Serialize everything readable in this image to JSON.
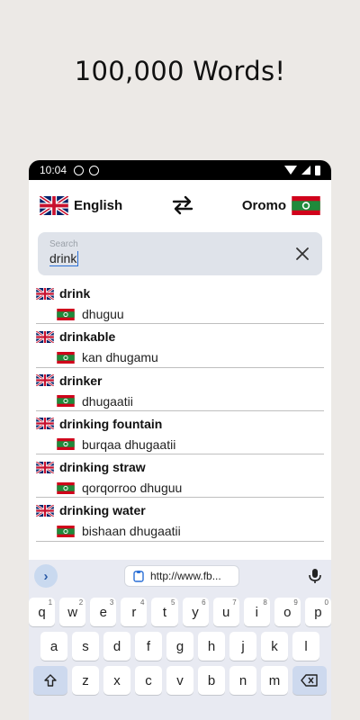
{
  "promo": {
    "headline": "100,000 Words!"
  },
  "status_bar": {
    "time": "10:04"
  },
  "language_bar": {
    "source_language": "English",
    "target_language": "Oromo",
    "source_flag_icon": "uk-flag-icon",
    "target_flag_icon": "oromo-flag-icon",
    "swap_icon": "swap-arrows-icon"
  },
  "search": {
    "placeholder": "Search",
    "value": "drink",
    "clear_icon": "close-icon"
  },
  "results": [
    {
      "en": "drink",
      "om": "dhuguu"
    },
    {
      "en": "drinkable",
      "om": "kan dhugamu"
    },
    {
      "en": "drinker",
      "om": "dhugaatii"
    },
    {
      "en": "drinking fountain",
      "om": "burqaa dhugaatii"
    },
    {
      "en": "drinking straw",
      "om": "qorqorroo dhuguu"
    },
    {
      "en": "drinking water",
      "om": "bishaan dhugaatii"
    }
  ],
  "keyboard": {
    "suggestion_url": "http://www.fb...",
    "expand_icon": "chevron-right-icon",
    "mic_icon": "mic-icon",
    "row1": [
      {
        "k": "q",
        "n": "1"
      },
      {
        "k": "w",
        "n": "2"
      },
      {
        "k": "e",
        "n": "3"
      },
      {
        "k": "r",
        "n": "4"
      },
      {
        "k": "t",
        "n": "5"
      },
      {
        "k": "y",
        "n": "6"
      },
      {
        "k": "u",
        "n": "7"
      },
      {
        "k": "i",
        "n": "8"
      },
      {
        "k": "o",
        "n": "9"
      },
      {
        "k": "p",
        "n": "0"
      }
    ],
    "row2": [
      "a",
      "s",
      "d",
      "f",
      "g",
      "h",
      "j",
      "k",
      "l"
    ],
    "row3": [
      "z",
      "x",
      "c",
      "v",
      "b",
      "n",
      "m"
    ],
    "shift_icon": "shift-icon",
    "backspace_icon": "backspace-icon"
  },
  "colors": {
    "search_bg": "#dfe3ea",
    "accent": "#2a6fd6",
    "oromo_red": "#d0021b",
    "oromo_green": "#1f8a3b"
  }
}
